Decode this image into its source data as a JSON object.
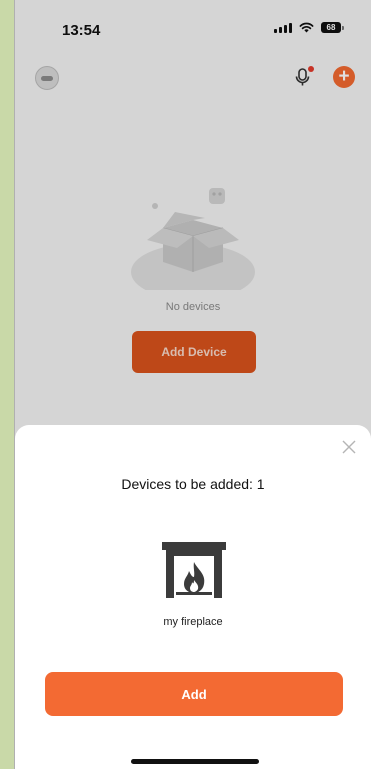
{
  "status_bar": {
    "time": "13:54",
    "battery": "68"
  },
  "topbar": {
    "avatar_icon": "user-avatar-icon",
    "mic_icon": "microphone-icon",
    "add_icon": "plus-circle-icon",
    "accent_color": "#f26930"
  },
  "home": {
    "empty_text": "No devices",
    "add_device_label": "Add Device"
  },
  "sheet": {
    "title": "Devices to be added: 1",
    "devices": [
      {
        "name": "my fireplace",
        "icon": "fireplace-icon"
      }
    ],
    "add_label": "Add",
    "close_icon": "close-icon",
    "button_color": "#f36a33"
  }
}
